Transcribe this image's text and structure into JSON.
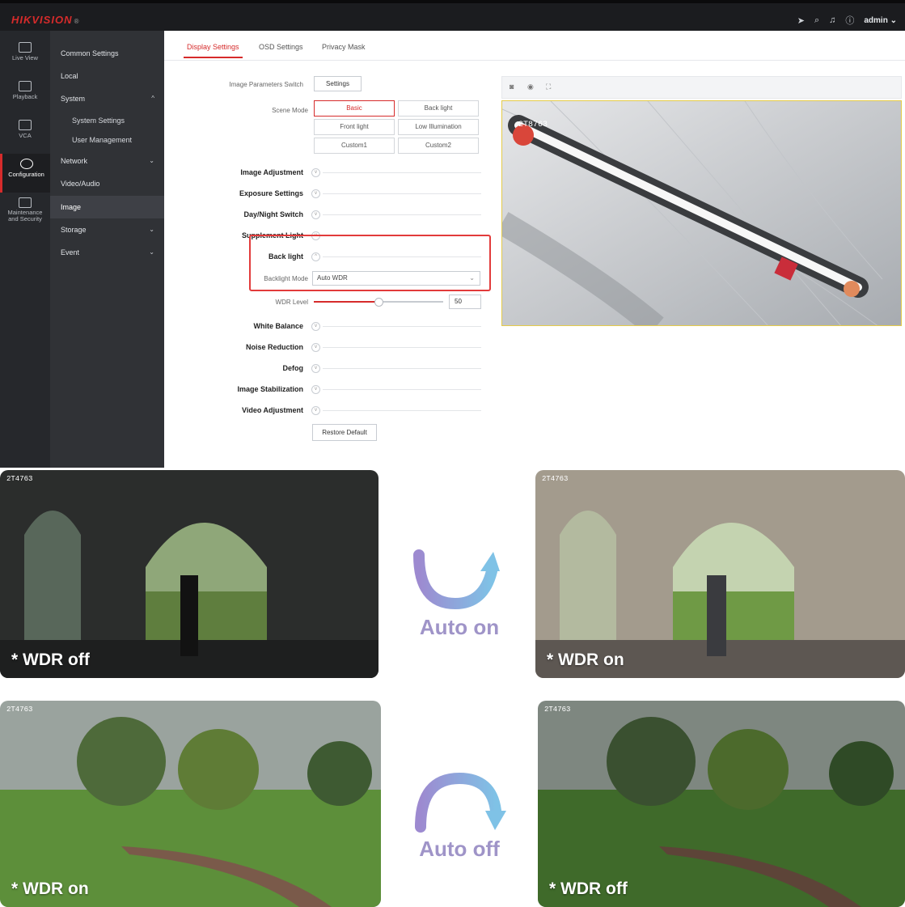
{
  "brand": {
    "logo": "HIKVISION",
    "reg": "®"
  },
  "topbar": {
    "user": "admin",
    "icons": [
      "send-icon",
      "search-icon",
      "bell-icon",
      "info-icon"
    ]
  },
  "iconnav": [
    {
      "label": "Live View",
      "icon": "monitor-icon"
    },
    {
      "label": "Playback",
      "icon": "playback-icon"
    },
    {
      "label": "VCA",
      "icon": "grid-icon"
    },
    {
      "label": "Configuration",
      "icon": "gear-icon",
      "active": true
    },
    {
      "label": "Maintenance and Security",
      "icon": "wrench-icon"
    }
  ],
  "menu": [
    {
      "label": "Common Settings"
    },
    {
      "label": "Local"
    },
    {
      "label": "System",
      "chev": "^"
    },
    {
      "label": "System Settings",
      "sub": true
    },
    {
      "label": "User Management",
      "sub": true
    },
    {
      "label": "Network",
      "chev": "v"
    },
    {
      "label": "Video/Audio"
    },
    {
      "label": "Image",
      "active": true
    },
    {
      "label": "Storage",
      "chev": "v"
    },
    {
      "label": "Event",
      "chev": "v"
    }
  ],
  "tabs": [
    "Display Settings",
    "OSD Settings",
    "Privacy Mask"
  ],
  "form": {
    "image_param_label": "Image Parameters Switch",
    "image_param_button": "Settings",
    "scene_label": "Scene Mode",
    "scene_modes": [
      "Basic",
      "Back light",
      "Front light",
      "Low Illumination",
      "Custom1",
      "Custom2"
    ],
    "scene_selected": "Basic",
    "sections_top": [
      "Image Adjustment",
      "Exposure Settings",
      "Day/Night Switch",
      "Supplement Light",
      "Back light"
    ],
    "backlight_mode_label": "Backlight Mode",
    "backlight_mode_value": "Auto WDR",
    "wdr_label": "WDR Level",
    "wdr_value": "50",
    "wdr_fraction": 0.5,
    "sections_bottom": [
      "White Balance",
      "Noise Reduction",
      "Defog",
      "Image Stabilization",
      "Video Adjustment"
    ],
    "restore_button": "Restore Default"
  },
  "preview": {
    "osd": "2T8763",
    "tools": [
      "camera-icon",
      "record-icon",
      "fullscreen-icon"
    ]
  },
  "comparisons": [
    {
      "id": "2T4763",
      "caption": "* WDR off"
    },
    {
      "id": "2T4763",
      "caption": "* WDR on"
    },
    {
      "id": "2T4763",
      "caption": "* WDR on"
    },
    {
      "id": "2T4763",
      "caption": "* WDR off"
    }
  ],
  "transitions": [
    "Auto on",
    "Auto off"
  ]
}
